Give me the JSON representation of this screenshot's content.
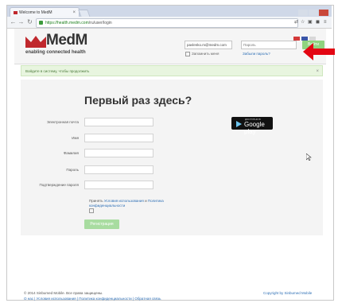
{
  "browser": {
    "tab_title": "Welcome to MedM",
    "url_scheme": "https://",
    "url_host": "health.medm.com",
    "url_path": "/ru/user/login",
    "tab_close": "×"
  },
  "header": {
    "logo_text": "MedM",
    "logo_tagline": "enabling connected health",
    "email_value": "pavlenko.m@medm.com",
    "password_placeholder": "Пароль",
    "login_label": "Войти",
    "remember_label": "Запомнить меня",
    "forgot_label": "Забыли пароль?"
  },
  "info_bar": {
    "text": "Войдите в систему, чтобы продолжить",
    "close": "×"
  },
  "form": {
    "title": "Первый раз здесь?",
    "fields": [
      {
        "label": "Электронная почта"
      },
      {
        "label": "Имя"
      },
      {
        "label": "Фамилия"
      },
      {
        "label": "Пароль"
      },
      {
        "label": "Подтверждение пароля"
      }
    ],
    "accept_prefix": "Принять",
    "terms_link": "Условия использования",
    "and": "и",
    "privacy_link": "Политика конфиденциальности",
    "register_label": "Регистрация"
  },
  "google_play": {
    "small_text": "ДОСТУПНО В",
    "big_text": "Google play"
  },
  "footer": {
    "copyright": "© 2014 Sinbumed Mobile. Все права защищены.",
    "links": "О нас | Условия использования | Политика конфиденциальности | Обратная связь",
    "right": "Copyright by Sinbumed Mobile"
  },
  "colors": {
    "brand_red": "#c0282d",
    "accent_green": "#8fd47f",
    "arrow_red": "#e30613"
  }
}
